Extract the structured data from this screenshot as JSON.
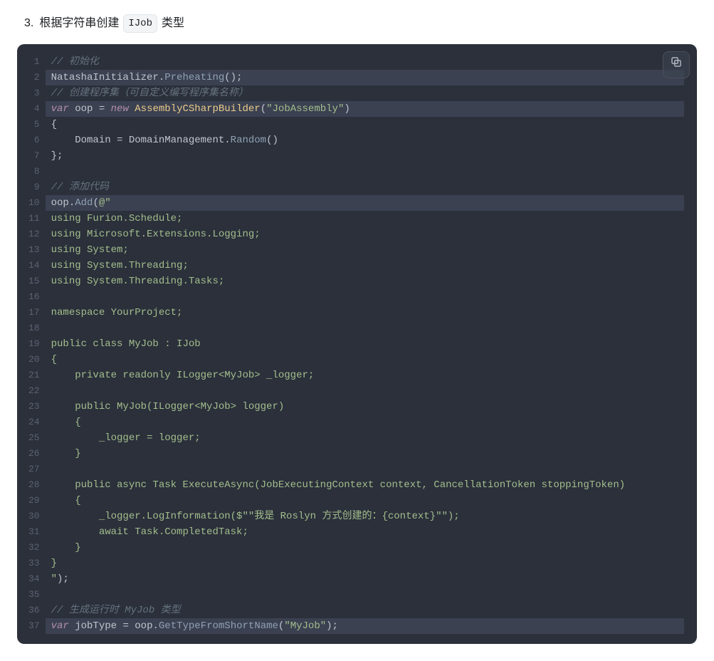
{
  "heading": {
    "number": "3.",
    "before": "根据字符串创建",
    "code": "IJob",
    "after": "类型"
  },
  "copy_btn": {
    "aria": "Copy code"
  },
  "code": {
    "highlighted_lines": [
      2,
      4,
      10,
      37
    ],
    "lines": [
      [
        {
          "c": "c-cm",
          "t": "// 初始化"
        }
      ],
      [
        {
          "c": "c-id",
          "t": "NatashaInitializer"
        },
        {
          "c": "c-pn",
          "t": "."
        },
        {
          "c": "c-fn",
          "t": "Preheating"
        },
        {
          "c": "c-pn",
          "t": "();"
        }
      ],
      [
        {
          "c": "c-cm",
          "t": "// 创建程序集（可自定义编写程序集名称）"
        }
      ],
      [
        {
          "c": "c-kw",
          "t": "var"
        },
        {
          "c": "c-id",
          "t": " oop "
        },
        {
          "c": "c-op",
          "t": "= "
        },
        {
          "c": "c-kw",
          "t": "new"
        },
        {
          "c": "c-id",
          "t": " "
        },
        {
          "c": "c-cls",
          "t": "AssemblyCSharpBuilder"
        },
        {
          "c": "c-pn",
          "t": "("
        },
        {
          "c": "c-str",
          "t": "\"JobAssembly\""
        },
        {
          "c": "c-pn",
          "t": ")"
        }
      ],
      [
        {
          "c": "c-pn",
          "t": "{"
        }
      ],
      [
        {
          "c": "c-id",
          "t": "    Domain "
        },
        {
          "c": "c-op",
          "t": "= "
        },
        {
          "c": "c-id",
          "t": "DomainManagement"
        },
        {
          "c": "c-pn",
          "t": "."
        },
        {
          "c": "c-fn",
          "t": "Random"
        },
        {
          "c": "c-pn",
          "t": "()"
        }
      ],
      [
        {
          "c": "c-pn",
          "t": "};"
        }
      ],
      [
        {
          "c": "c-id",
          "t": ""
        }
      ],
      [
        {
          "c": "c-cm",
          "t": "// 添加代码"
        }
      ],
      [
        {
          "c": "c-id",
          "t": "oop"
        },
        {
          "c": "c-pn",
          "t": "."
        },
        {
          "c": "c-fn",
          "t": "Add"
        },
        {
          "c": "c-pn",
          "t": "("
        },
        {
          "c": "c-str",
          "t": "@\""
        }
      ],
      [
        {
          "c": "c-str",
          "t": "using Furion.Schedule;"
        }
      ],
      [
        {
          "c": "c-str",
          "t": "using Microsoft.Extensions.Logging;"
        }
      ],
      [
        {
          "c": "c-str",
          "t": "using System;"
        }
      ],
      [
        {
          "c": "c-str",
          "t": "using System.Threading;"
        }
      ],
      [
        {
          "c": "c-str",
          "t": "using System.Threading.Tasks;"
        }
      ],
      [
        {
          "c": "c-str",
          "t": ""
        }
      ],
      [
        {
          "c": "c-str",
          "t": "namespace YourProject;"
        }
      ],
      [
        {
          "c": "c-str",
          "t": ""
        }
      ],
      [
        {
          "c": "c-str",
          "t": "public class MyJob : IJob"
        }
      ],
      [
        {
          "c": "c-str",
          "t": "{"
        }
      ],
      [
        {
          "c": "c-str",
          "t": "    private readonly ILogger<MyJob> _logger;"
        }
      ],
      [
        {
          "c": "c-str",
          "t": ""
        }
      ],
      [
        {
          "c": "c-str",
          "t": "    public MyJob(ILogger<MyJob> logger)"
        }
      ],
      [
        {
          "c": "c-str",
          "t": "    {"
        }
      ],
      [
        {
          "c": "c-str",
          "t": "        _logger = logger;"
        }
      ],
      [
        {
          "c": "c-str",
          "t": "    }"
        }
      ],
      [
        {
          "c": "c-str",
          "t": ""
        }
      ],
      [
        {
          "c": "c-str",
          "t": "    public async Task ExecuteAsync(JobExecutingContext context, CancellationToken stoppingToken)"
        }
      ],
      [
        {
          "c": "c-str",
          "t": "    {"
        }
      ],
      [
        {
          "c": "c-str",
          "t": "        _logger.LogInformation($\"\"我是 Roslyn 方式创建的：{context}\"\");"
        }
      ],
      [
        {
          "c": "c-str",
          "t": "        await Task.CompletedTask;"
        }
      ],
      [
        {
          "c": "c-str",
          "t": "    }"
        }
      ],
      [
        {
          "c": "c-str",
          "t": "}"
        }
      ],
      [
        {
          "c": "c-str",
          "t": "\""
        },
        {
          "c": "c-pn",
          "t": ");"
        }
      ],
      [
        {
          "c": "c-id",
          "t": ""
        }
      ],
      [
        {
          "c": "c-cm",
          "t": "// 生成运行时 MyJob 类型"
        }
      ],
      [
        {
          "c": "c-kw",
          "t": "var"
        },
        {
          "c": "c-id",
          "t": " jobType "
        },
        {
          "c": "c-op",
          "t": "= "
        },
        {
          "c": "c-id",
          "t": "oop"
        },
        {
          "c": "c-pn",
          "t": "."
        },
        {
          "c": "c-fn",
          "t": "GetTypeFromShortName"
        },
        {
          "c": "c-pn",
          "t": "("
        },
        {
          "c": "c-str",
          "t": "\"MyJob\""
        },
        {
          "c": "c-pn",
          "t": ");"
        }
      ]
    ]
  }
}
